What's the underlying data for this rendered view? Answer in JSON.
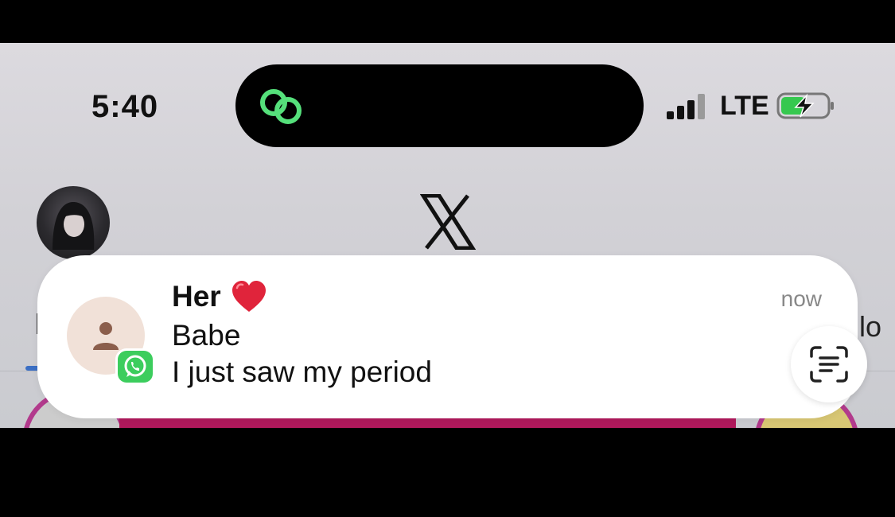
{
  "status_bar": {
    "time": "5:40",
    "network": "LTE",
    "icons": [
      "signal-bars-icon",
      "battery-charging-icon",
      "dynamic-island-activity-icon"
    ]
  },
  "app": {
    "logo": "X",
    "background_fragment_text": "lo"
  },
  "notification": {
    "title": "Her",
    "title_emoji": "heart",
    "time": "now",
    "line1": "Babe",
    "line2": "I just saw my period",
    "app": "WhatsApp"
  },
  "colors": {
    "accent_green": "#3ccd5d",
    "notification_bg": "#ffffff",
    "heart_red": "#e0243b",
    "tab_indicator": "#3b6fc4",
    "pink_banner": "#b0195c"
  }
}
